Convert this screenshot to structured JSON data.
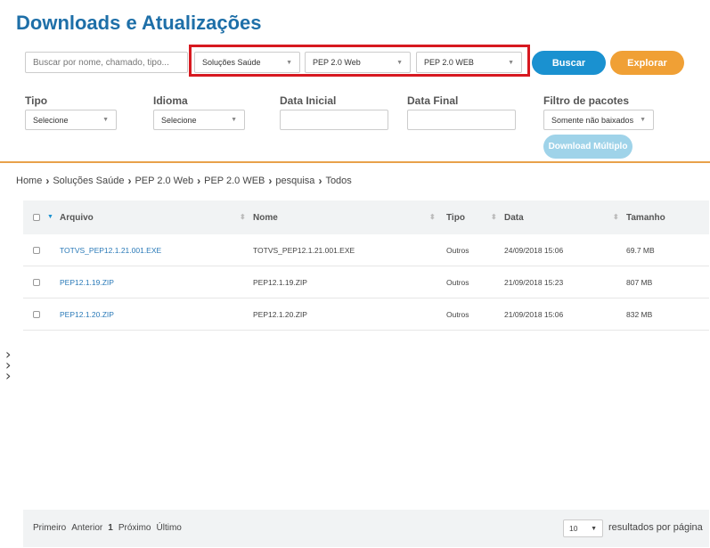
{
  "page": {
    "title": "Downloads e Atualizações"
  },
  "search": {
    "placeholder": "Buscar por nome, chamado, tipo..."
  },
  "selects": {
    "solution": "Soluções Saúde",
    "product": "PEP 2.0 Web",
    "version": "PEP 2.0 WEB"
  },
  "buttons": {
    "buscar": "Buscar",
    "explorar": "Explorar",
    "download_multiplo": "Download Múltiplo"
  },
  "filters": {
    "tipo_label": "Tipo",
    "tipo_value": "Selecione",
    "idioma_label": "Idioma",
    "idioma_value": "Selecione",
    "data_inicial_label": "Data Inicial",
    "data_final_label": "Data Final",
    "filtro_pacotes_label": "Filtro de pacotes",
    "filtro_pacotes_value": "Somente não baixados"
  },
  "breadcrumb": [
    "Home",
    "Soluções Saúde",
    "PEP 2.0 Web",
    "PEP 2.0 WEB",
    "pesquisa",
    "Todos"
  ],
  "table": {
    "headers": {
      "arquivo": "Arquivo",
      "nome": "Nome",
      "tipo": "Tipo",
      "data": "Data",
      "tamanho": "Tamanho"
    },
    "rows": [
      {
        "arquivo": "TOTVS_PEP12.1.21.001.EXE",
        "nome": "TOTVS_PEP12.1.21.001.EXE",
        "tipo": "Outros",
        "data": "24/09/2018 15:06",
        "tamanho": "69.7 MB"
      },
      {
        "arquivo": "PEP12.1.19.ZIP",
        "nome": "PEP12.1.19.ZIP",
        "tipo": "Outros",
        "data": "21/09/2018 15:23",
        "tamanho": "807 MB"
      },
      {
        "arquivo": "PEP12.1.20.ZIP",
        "nome": "PEP12.1.20.ZIP",
        "tipo": "Outros",
        "data": "21/09/2018 15:06",
        "tamanho": "832 MB"
      }
    ]
  },
  "pager": {
    "first": "Primeiro",
    "prev": "Anterior",
    "current": "1",
    "next": "Próximo",
    "last": "Último",
    "page_size": "10",
    "per_page_label": "resultados por página"
  },
  "colors": {
    "title": "#1e6fa8",
    "buscar": "#1a91d0",
    "explorar": "#f0a035",
    "highlight": "#d71920",
    "divider": "#e8a14a"
  }
}
